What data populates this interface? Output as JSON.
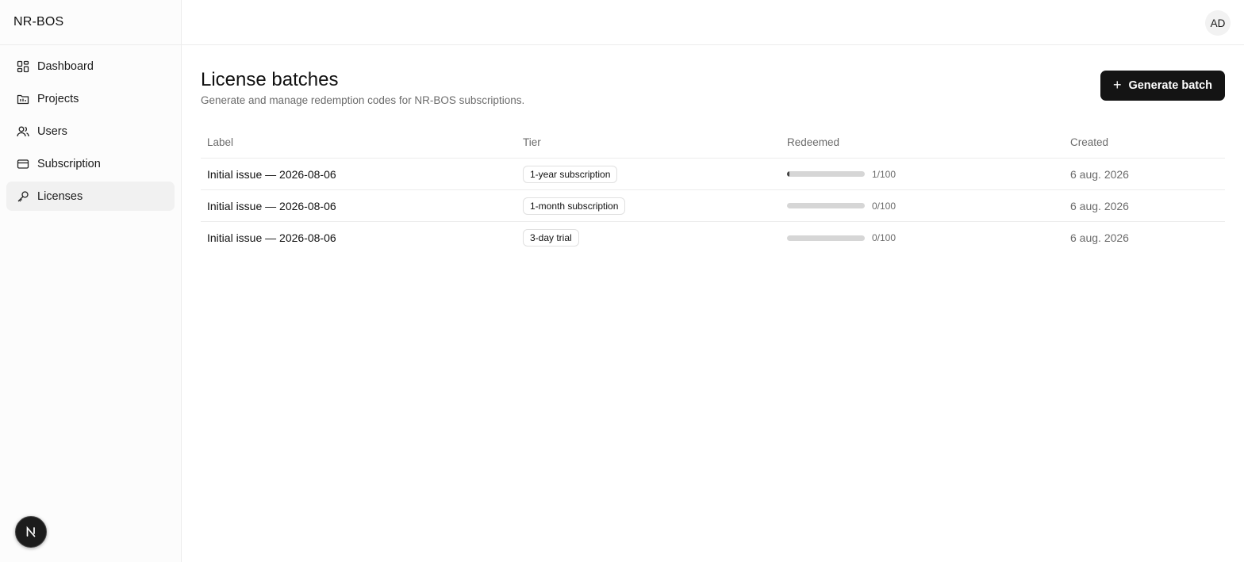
{
  "app": {
    "brand": "NR-BOS"
  },
  "sidebar": {
    "items": [
      {
        "label": "Dashboard",
        "icon": "dashboard-icon",
        "active": false
      },
      {
        "label": "Projects",
        "icon": "folder-icon",
        "active": false
      },
      {
        "label": "Users",
        "icon": "users-icon",
        "active": false
      },
      {
        "label": "Subscription",
        "icon": "credit-card-icon",
        "active": false
      },
      {
        "label": "Licenses",
        "icon": "key-icon",
        "active": true
      }
    ]
  },
  "user": {
    "initials": "AD"
  },
  "page": {
    "title": "License batches",
    "subtitle": "Generate and manage redemption codes for NR-BOS subscriptions.",
    "generate_label": "Generate batch"
  },
  "table": {
    "headers": {
      "label": "Label",
      "tier": "Tier",
      "redeemed": "Redeemed",
      "created": "Created"
    },
    "rows": [
      {
        "label": "Initial issue — 2026-08-06",
        "tier": "1-year subscription",
        "redeemed_count": 1,
        "redeemed_total": 100,
        "redeemed_text": "1/100",
        "created": "6 aug. 2026"
      },
      {
        "label": "Initial issue — 2026-08-06",
        "tier": "1-month subscription",
        "redeemed_count": 0,
        "redeemed_total": 100,
        "redeemed_text": "0/100",
        "created": "6 aug. 2026"
      },
      {
        "label": "Initial issue — 2026-08-06",
        "tier": "3-day trial",
        "redeemed_count": 0,
        "redeemed_total": 100,
        "redeemed_text": "0/100",
        "created": "6 aug. 2026"
      }
    ]
  },
  "colors": {
    "accent": "#141414",
    "progress_track": "#d6d6d6",
    "progress_fill": "#444444",
    "muted_text": "#6b6b6b"
  }
}
